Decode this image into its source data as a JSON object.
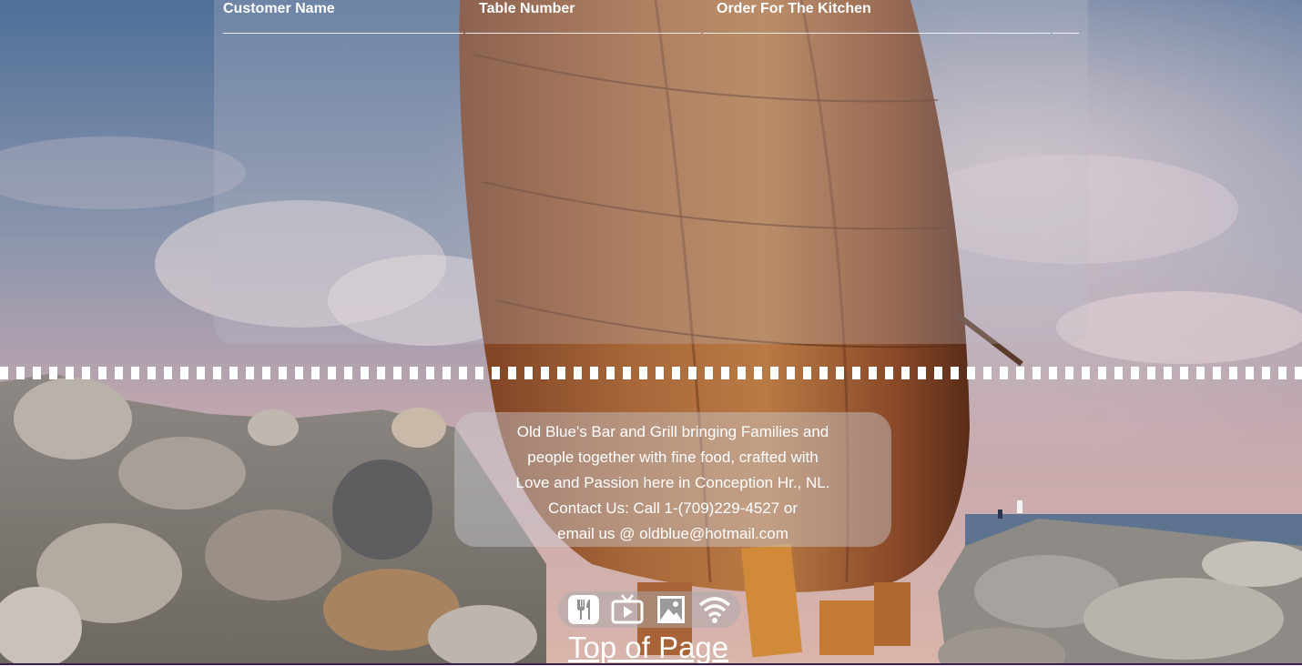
{
  "table": {
    "headers": [
      "Customer Name",
      "Table Number",
      "Order For The Kitchen"
    ]
  },
  "info": {
    "lines": [
      "Old Blue's Bar and Grill bringing Families and",
      "people together with fine food, crafted with",
      "Love and Passion here in Conception Hr., NL.",
      "Contact Us: Call 1-(709)229-4527 or",
      "email us @ oldblue@hotmail.com"
    ]
  },
  "icons": [
    "food-icon",
    "tv-icon",
    "image-icon",
    "wifi-icon"
  ],
  "footer": {
    "top_link": "Top of Page"
  }
}
